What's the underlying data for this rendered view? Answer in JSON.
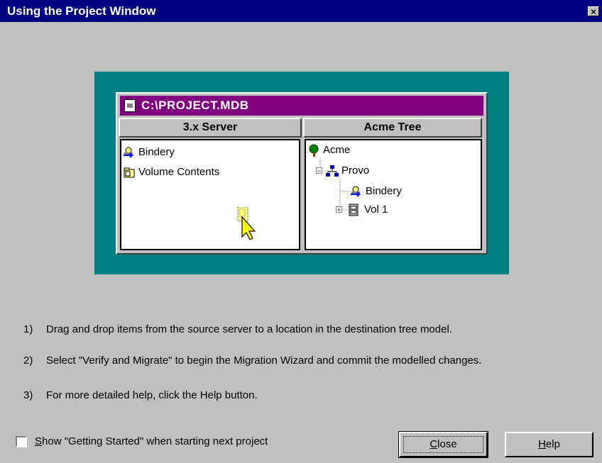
{
  "window": {
    "title": "Using the Project Window",
    "close_glyph": "×"
  },
  "illustration": {
    "frame_color": "#008080",
    "title_color": "#800080",
    "db_title": "C:\\PROJECT.MDB",
    "left_pane": {
      "header": "3.x Server",
      "items": [
        {
          "label": "Bindery",
          "icon": "bindery-icon"
        },
        {
          "label": "Volume Contents",
          "icon": "volume-contents-icon"
        }
      ]
    },
    "right_pane": {
      "header": "Acme Tree",
      "items": [
        {
          "label": "Acme",
          "icon": "tree-icon"
        },
        {
          "label": "Provo",
          "icon": "organization-icon"
        },
        {
          "label": "Bindery",
          "icon": "bindery-icon"
        },
        {
          "label": "Vol 1",
          "icon": "volume-icon"
        }
      ]
    }
  },
  "instructions": [
    {
      "num": "1)",
      "text": "Drag and drop items from the source server to a location in the destination tree model."
    },
    {
      "num": "2)",
      "text": "Select \"Verify and Migrate\" to begin the Migration Wizard and commit the modelled changes."
    },
    {
      "num": "3)",
      "text": "For more detailed help, click the Help button."
    }
  ],
  "checkbox": {
    "mnemonic": "S",
    "label_rest": "how \"Getting Started\" when starting next project",
    "checked": false
  },
  "buttons": {
    "close": {
      "mnemonic": "C",
      "rest": "lose"
    },
    "help": {
      "mnemonic": "H",
      "rest": "elp"
    }
  }
}
